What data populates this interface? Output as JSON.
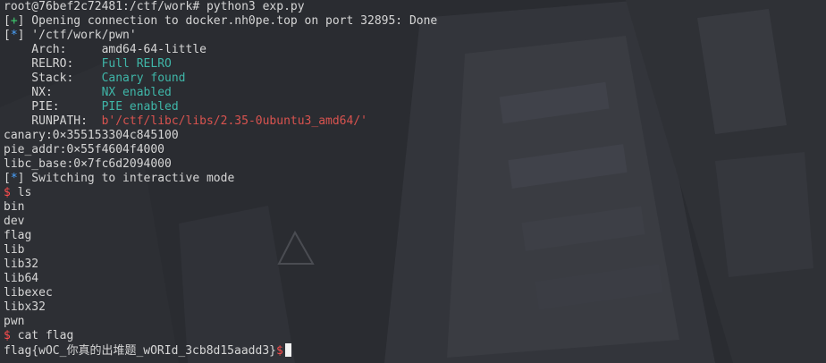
{
  "terminal": {
    "lines": [
      {
        "parts": [
          {
            "t": "root@76bef2c72481:/ctf/work# python3 exp.py",
            "c": ""
          }
        ]
      },
      {
        "parts": [
          {
            "t": "[",
            "c": ""
          },
          {
            "t": "+",
            "c": "g"
          },
          {
            "t": "] Opening connection to docker.nh0pe.top on port 32895: Done",
            "c": ""
          }
        ]
      },
      {
        "parts": [
          {
            "t": "[",
            "c": ""
          },
          {
            "t": "*",
            "c": "b"
          },
          {
            "t": "] '/ctf/work/pwn'",
            "c": ""
          }
        ]
      },
      {
        "parts": [
          {
            "t": "    Arch:     amd64-64-little",
            "c": ""
          }
        ]
      },
      {
        "parts": [
          {
            "t": "    RELRO:    ",
            "c": ""
          },
          {
            "t": "Full RELRO",
            "c": "c"
          }
        ]
      },
      {
        "parts": [
          {
            "t": "    Stack:    ",
            "c": ""
          },
          {
            "t": "Canary found",
            "c": "c"
          }
        ]
      },
      {
        "parts": [
          {
            "t": "    NX:       ",
            "c": ""
          },
          {
            "t": "NX enabled",
            "c": "c"
          }
        ]
      },
      {
        "parts": [
          {
            "t": "    PIE:      ",
            "c": ""
          },
          {
            "t": "PIE enabled",
            "c": "c"
          }
        ]
      },
      {
        "parts": [
          {
            "t": "    RUNPATH:  ",
            "c": ""
          },
          {
            "t": "b'/ctf/libc/libs/2.35-0ubuntu3_amd64/'",
            "c": "r"
          }
        ]
      },
      {
        "parts": [
          {
            "t": "canary:0×355153304c845100",
            "c": ""
          }
        ]
      },
      {
        "parts": [
          {
            "t": "pie_addr:0×55f4604f4000",
            "c": ""
          }
        ]
      },
      {
        "parts": [
          {
            "t": "libc_base:0×7fc6d2094000",
            "c": ""
          }
        ]
      },
      {
        "parts": [
          {
            "t": "[",
            "c": ""
          },
          {
            "t": "*",
            "c": "b"
          },
          {
            "t": "] Switching to interactive mode",
            "c": ""
          }
        ]
      },
      {
        "parts": [
          {
            "t": "$",
            "c": "dollar"
          },
          {
            "t": " ls",
            "c": ""
          }
        ]
      },
      {
        "parts": [
          {
            "t": "bin",
            "c": ""
          }
        ]
      },
      {
        "parts": [
          {
            "t": "dev",
            "c": ""
          }
        ]
      },
      {
        "parts": [
          {
            "t": "flag",
            "c": ""
          }
        ]
      },
      {
        "parts": [
          {
            "t": "lib",
            "c": ""
          }
        ]
      },
      {
        "parts": [
          {
            "t": "lib32",
            "c": ""
          }
        ]
      },
      {
        "parts": [
          {
            "t": "lib64",
            "c": ""
          }
        ]
      },
      {
        "parts": [
          {
            "t": "libexec",
            "c": ""
          }
        ]
      },
      {
        "parts": [
          {
            "t": "libx32",
            "c": ""
          }
        ]
      },
      {
        "parts": [
          {
            "t": "pwn",
            "c": ""
          }
        ]
      },
      {
        "parts": [
          {
            "t": "$",
            "c": "dollar"
          },
          {
            "t": " cat flag",
            "c": ""
          }
        ]
      },
      {
        "parts": [
          {
            "t": "flag{wOC_你真的出堆题_wORId_3cb8d15aadd3}",
            "c": ""
          },
          {
            "t": "$",
            "c": "dollar"
          }
        ],
        "cursor": true
      }
    ]
  },
  "colors": {
    "background": "#2a2c31",
    "text": "#d6d6d6",
    "success": "#3fcf6f",
    "info": "#4aa3ff",
    "enabled": "#3fb6a8",
    "path": "#d9534f",
    "prompt": "#ff4d4d"
  }
}
